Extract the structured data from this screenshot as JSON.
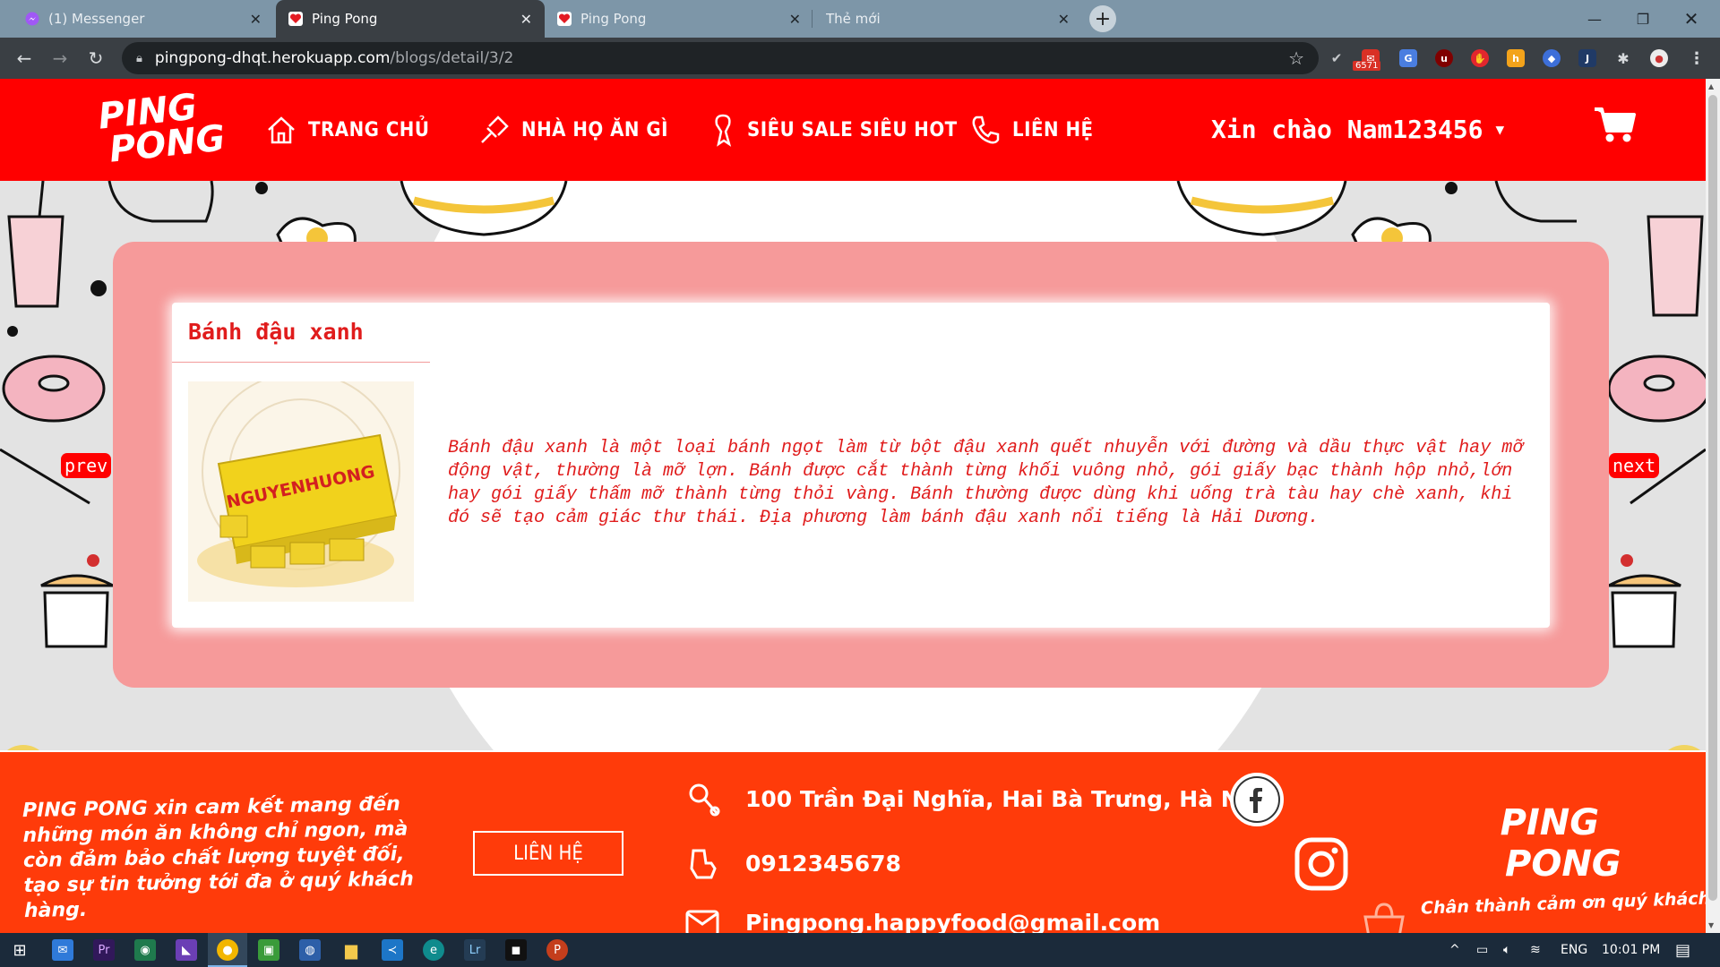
{
  "browser": {
    "tabs": [
      {
        "title": "(1) Messenger",
        "icon": "messenger-icon",
        "active": false
      },
      {
        "title": "Ping Pong",
        "icon": "heart-icon",
        "active": true
      },
      {
        "title": "Ping Pong",
        "icon": "heart-icon",
        "active": false
      },
      {
        "title": "Thẻ mới",
        "icon": "",
        "active": false
      }
    ],
    "url_host": "pingpong-dhqt.herokuapp.com",
    "url_path": "/blogs/detail/3/2",
    "gmail_badge": "6571"
  },
  "site": {
    "logo_line1": "PING",
    "logo_line2": "PONG",
    "nav": [
      {
        "label": "TRANG CHỦ",
        "icon": "home-icon"
      },
      {
        "label": "NHÀ HỌ ĂN GÌ",
        "icon": "pin-icon"
      },
      {
        "label": "SIÊU SALE SIÊU HOT",
        "icon": "gift-icon"
      },
      {
        "label": "LIÊN HỆ",
        "icon": "phone-icon"
      }
    ],
    "greeting": "Xin chào Nam123456",
    "post": {
      "title": "Bánh đậu xanh",
      "image_brand": "NGUYENHUONG",
      "body": "Bánh đậu xanh là một loại bánh ngọt làm từ bột đậu xanh quết nhuyễn với đường và dầu thực vật hay mỡ động vật, thường là mỡ lợn. Bánh được cắt thành từng khối vuông nhỏ, gói giấy bạc thành hộp nhỏ,lớn hay gói giấy thấm mỡ thành từng thỏi vàng. Bánh thường được dùng khi uống trà tàu hay chè xanh, khi đó sẽ tạo cảm giác thư thái. Địa phương làm bánh đậu xanh nổi tiếng là Hải Dương."
    },
    "prev_label": "prev",
    "next_label": "next",
    "footer": {
      "tagline": "PING PONG xin cam kết mang đến những món ăn không chỉ ngon, mà còn đảm bảo chất lượng tuyệt đối, tạo sự tin tưởng tới đa ở quý khách hàng.",
      "contact_button": "LIÊN HỆ",
      "address": "100 Trần Đại Nghĩa, Hai Bà Trưng, Hà Nội",
      "phone": "0912345678",
      "email": "Pingpong.happyfood@gmail.com",
      "logo_line1": "PING",
      "logo_line2": "PONG",
      "thanks": "Chân thành cảm ơn quý khách"
    }
  },
  "taskbar": {
    "lang": "ENG",
    "time": "10:01 PM"
  },
  "colors": {
    "header_red": "#ff0000",
    "card_pink": "#f69a9a",
    "footer_orange": "#ff3b0a",
    "text_red": "#e01c1c"
  }
}
